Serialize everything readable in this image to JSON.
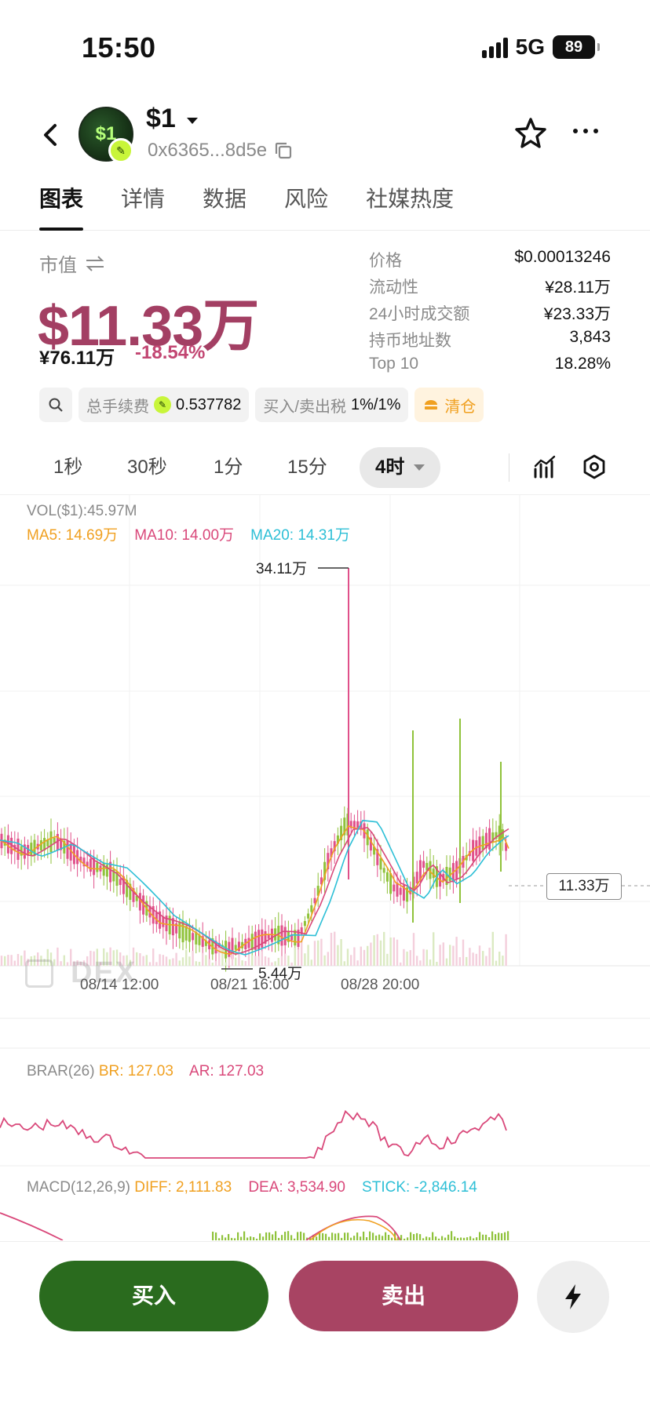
{
  "status": {
    "time": "15:50",
    "network": "5G",
    "battery": "89"
  },
  "header": {
    "token_name": "$1",
    "avatar_text": "$1",
    "address": "0x6365...8d5e"
  },
  "tabs": [
    {
      "label": "图表"
    },
    {
      "label": "详情"
    },
    {
      "label": "数据"
    },
    {
      "label": "风险"
    },
    {
      "label": "社媒热度"
    }
  ],
  "market": {
    "label": "市值",
    "value": "$11.33万",
    "cny": "¥76.11万",
    "change": "-18.54%",
    "stats": [
      {
        "label": "价格",
        "value": "$0.00013246"
      },
      {
        "label": "流动性",
        "value": "¥28.11万"
      },
      {
        "label": "24小时成交额",
        "value": "¥23.33万"
      },
      {
        "label": "持币地址数",
        "value": "3,843"
      },
      {
        "label": "Top 10",
        "value": "18.28%"
      }
    ]
  },
  "chips": {
    "gas_label": "总手续费",
    "gas_value": "0.537782",
    "tax_label": "买入/卖出税",
    "tax_value": "1%/1%",
    "clear_label": "清仓"
  },
  "timeframes": [
    {
      "label": "1秒"
    },
    {
      "label": "30秒"
    },
    {
      "label": "1分"
    },
    {
      "label": "15分"
    },
    {
      "label": "4时"
    }
  ],
  "chart": {
    "vol_legend": "VOL($1):45.97M",
    "ma5": "MA5: 14.69万",
    "ma10": "MA10: 14.00万",
    "ma20": "MA20: 14.31万",
    "max_label": "34.11万",
    "min_label": "5.44万",
    "current_price": "11.33万",
    "x_labels": [
      "08/14 12:00",
      "08/21 16:00",
      "08/28 20:00"
    ],
    "watermark": "DEX",
    "brar_legend": "BRAR(26)",
    "br": "BR: 127.03",
    "ar": "AR: 127.03",
    "macd_legend": "MACD(12,26,9)",
    "diff": "DIFF: 2,111.83",
    "dea": "DEA: 3,534.90",
    "stick": "STICK: -2,846.14"
  },
  "actions": {
    "buy": "买入",
    "sell": "卖出"
  },
  "colors": {
    "up": "#8fc23a",
    "down": "#e0508a",
    "ma5": "#f0a020",
    "ma10": "#d9487a",
    "ma20": "#2dbfd6",
    "buy": "#2a6b1e",
    "sell": "#a84463"
  }
}
